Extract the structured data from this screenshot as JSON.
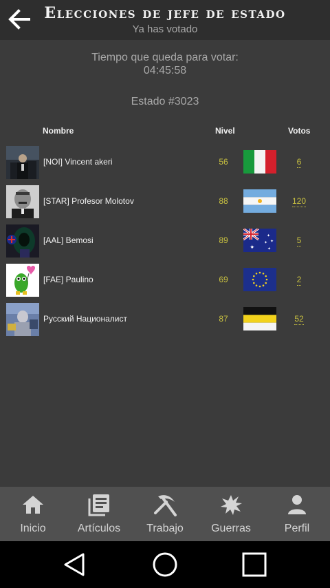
{
  "header": {
    "title": "Elecciones de jefe de estado",
    "subtitle": "Ya has votado",
    "back_icon": "arrow-left-icon"
  },
  "timer": {
    "label": "Tiempo que queda para votar:",
    "value": "04:45:58"
  },
  "state": "Estado #3023",
  "table": {
    "columns": [
      "Nombre",
      "Nivel",
      "Votos"
    ],
    "rows": [
      {
        "name": "[NOI] Vincent akeri",
        "level": "56",
        "flag": "Italy",
        "votes": "6"
      },
      {
        "name": "[STAR] Profesor Molotov",
        "level": "88",
        "flag": "Argentina",
        "votes": "120"
      },
      {
        "name": "[AAL] Bemosi",
        "level": "89",
        "flag": "Australia",
        "votes": "5"
      },
      {
        "name": "[FAE] Paulino",
        "level": "69",
        "flag": "European Union",
        "votes": "2"
      },
      {
        "name": "Русский Националист",
        "level": "87",
        "flag": "Imperial Russia",
        "votes": "52"
      }
    ]
  },
  "nav": [
    {
      "label": "Inicio",
      "icon": "home-icon"
    },
    {
      "label": "Artículos",
      "icon": "articles-icon"
    },
    {
      "label": "Trabajo",
      "icon": "pickaxe-icon"
    },
    {
      "label": "Guerras",
      "icon": "explosion-icon"
    },
    {
      "label": "Perfil",
      "icon": "person-icon"
    }
  ],
  "system_nav": [
    "back-triangle-icon",
    "home-circle-icon",
    "recents-square-icon"
  ],
  "colors": {
    "background": "#3b3b3b",
    "header": "#2e2e2e",
    "bottom_nav": "#505050",
    "accent_yellow": "#c8c040",
    "muted_text": "#a8a8a8"
  }
}
